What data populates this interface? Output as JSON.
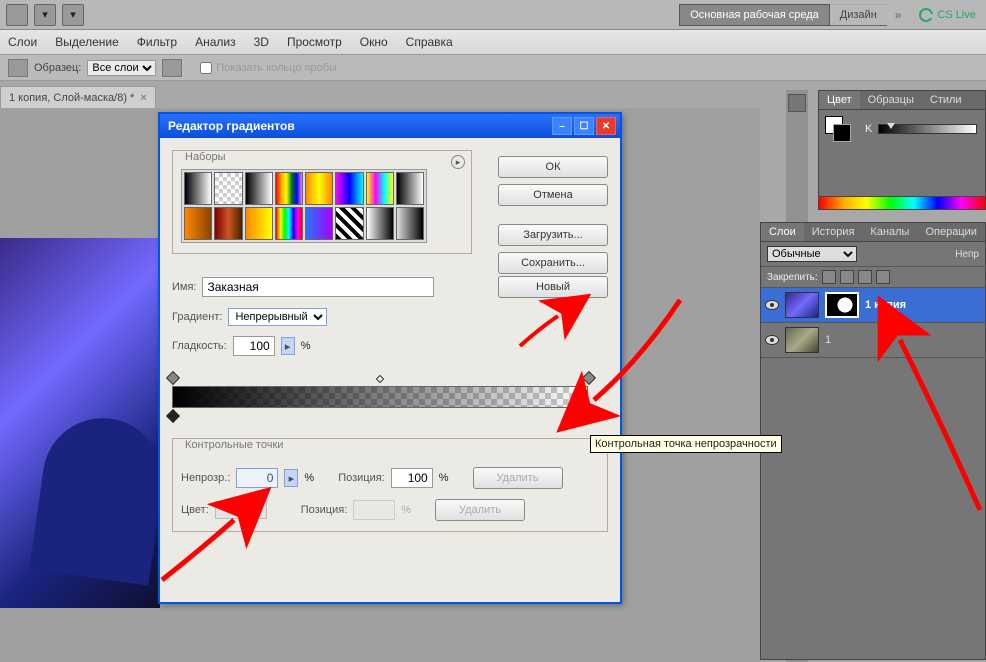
{
  "topbar": {
    "workspace_active": "Основная рабочая среда",
    "workspace_other": "Дизайн",
    "cs_live": "CS Live"
  },
  "menu": {
    "items": [
      "Слои",
      "Выделение",
      "Фильтр",
      "Анализ",
      "3D",
      "Просмотр",
      "Окно",
      "Справка"
    ]
  },
  "options": {
    "sample_label": "Образец:",
    "sample_value": "Все слои",
    "show_ring_label": "Показать кольцо пробы"
  },
  "doc_tab": {
    "title": "1 копия, Слой-маска/8) *"
  },
  "color_panel": {
    "tabs": [
      "Цвет",
      "Образцы",
      "Стили"
    ],
    "channel": "K"
  },
  "layers_panel": {
    "tabs": [
      "Слои",
      "История",
      "Каналы",
      "Операции"
    ],
    "blend_mode": "Обычные",
    "opacity_label": "Непр",
    "lock_label": "Закрепить:",
    "layers": [
      {
        "name": "1 копия",
        "selected": true,
        "has_mask": true
      },
      {
        "name": "1",
        "selected": false,
        "has_mask": false
      }
    ]
  },
  "dialog": {
    "title": "Редактор градиентов",
    "presets_label": "Наборы",
    "buttons": {
      "ok": "ОК",
      "cancel": "Отмена",
      "load": "Загрузить...",
      "save": "Сохранить...",
      "new": "Новый"
    },
    "name_label": "Имя:",
    "name_value": "Заказная",
    "gradient_type_label": "Градиент:",
    "gradient_type_value": "Непрерывный",
    "smoothness_label": "Гладкость:",
    "smoothness_value": "100",
    "stops_group_label": "Контрольные точки",
    "opacity_label": "Непрозр.:",
    "opacity_value": "0",
    "position_label": "Позиция:",
    "position_value": "100",
    "position2_value": "",
    "delete_label": "Удалить",
    "color_label": "Цвет:",
    "percent": "%"
  },
  "tooltip": "Контрольная точка непрозрачности",
  "preset_gradients": [
    "linear-gradient(90deg,#000,#fff)",
    "repeating-conic-gradient(#ccc 0 25%,#fff 0 50%) 0 0/8px 8px",
    "linear-gradient(90deg,#000,#fff)",
    "linear-gradient(90deg,red,orange,yellow,green,blue,violet)",
    "linear-gradient(90deg,#f80,#ff0,#f80)",
    "linear-gradient(90deg,#f0f,#00f,#0ff)",
    "linear-gradient(90deg,#ff0,#f0f,#0ff,#ff0)",
    "linear-gradient(90deg,#000,#fff)",
    "linear-gradient(90deg,#f80,#840)",
    "linear-gradient(90deg,#800000,#c52,#420)",
    "linear-gradient(90deg,#f80,#ff0)",
    "linear-gradient(90deg,red,yellow,lime,cyan,blue,magenta,red)",
    "linear-gradient(90deg,#27f,#a0f)",
    "repeating-linear-gradient(45deg,#000 0 4px,#fff 4px 8px)",
    "linear-gradient(90deg,#fff,#000)",
    "linear-gradient(90deg,rgba(0,0,0,0),#000)"
  ]
}
